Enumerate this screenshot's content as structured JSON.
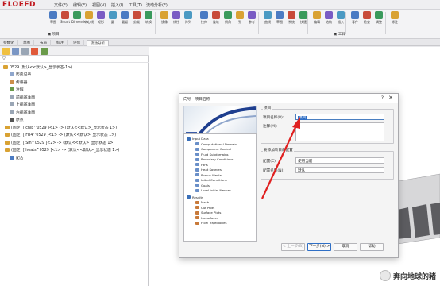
{
  "app": {
    "logo": "FLOEFD"
  },
  "menubar": {
    "items": [
      "文件(F)",
      "编辑(E)",
      "视图(V)",
      "插入(I)",
      "工具(T)",
      "流动分析(F)"
    ]
  },
  "ribbon": {
    "buttons": [
      "草图",
      "Smart",
      "Dimension",
      "中心线",
      "矩形",
      "圆",
      "圆弧",
      "剪裁",
      "转换",
      "镜像",
      "线性",
      "阵列",
      "拉伸",
      "旋转",
      "倒角",
      "孔",
      "参考",
      "曲线",
      "草图",
      "系统",
      "快速",
      "编辑",
      "结构",
      "插入",
      "零件",
      "检查",
      "调整",
      "标注"
    ],
    "small_rows": [
      "项目",
      "工具"
    ]
  },
  "tabs": [
    "参数化",
    "草图",
    "布局",
    "标注",
    "评估",
    "流动分析"
  ],
  "active_tab": "流动分析",
  "tree": {
    "root": "0529 (默认<<默认>_显示状态-1>)",
    "items": [
      "历史记录",
      "传感器",
      "注解",
      "前视基准面",
      "上视基准面",
      "右视基准面",
      "原点",
      "(固定) [ chip^0529 ]<1> -> (默认<<默认>_显示状态 1>)",
      "(固定) [ FR4^0529 ]<1> -> (默认<<默认>_显示状态 1>)",
      "(固定) [ Sin^0529 ]<2> -> (默认<<默认>_显示状态 1>)",
      "(固定) [ heats^0529 ]<1> -> (默认<<默认>_显示状态 1>)",
      "配合"
    ]
  },
  "dialog": {
    "title": "向导 - 项目名称",
    "help": "?",
    "close": "✕",
    "wizard_tree": {
      "input_data": "Input Data",
      "input_items": [
        "Computational Domain",
        "Component Control",
        "Fluid Subdomains",
        "Boundary Conditions",
        "Fans",
        "Heat Sources",
        "Porous Media",
        "Initial Conditions",
        "Goals",
        "Local Initial Meshes"
      ],
      "results": "Results",
      "result_items": [
        "Mesh",
        "Cut Plots",
        "Surface Plots",
        "Isosurfaces",
        "Flow Trajectories"
      ]
    },
    "project": {
      "group_label": "项目",
      "name_label": "项目名称(P):",
      "name_value": "项目",
      "comment_label": "注释(M):",
      "comment_value": ""
    },
    "config": {
      "group_label": "要添加项目的配置",
      "config_label": "配置(C):",
      "config_value": "使用当前",
      "name_label": "配置名称(N):",
      "name_value": "默认"
    },
    "buttons": {
      "prev": "< 上一步(B)",
      "next": "下一步(N) >",
      "cancel": "取消",
      "help": "帮助"
    }
  },
  "watermark": {
    "text": "奔向地球的猪"
  },
  "colors": {
    "accent": "#2f6fc6",
    "annotation_arrow": "#e02020",
    "logo": "#c0161c"
  }
}
